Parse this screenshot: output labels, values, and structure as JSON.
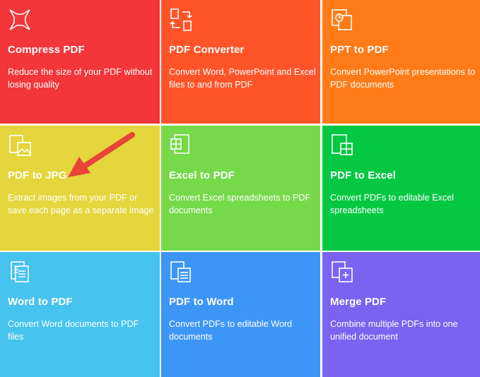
{
  "tiles": [
    {
      "key": "compress",
      "title": "Compress PDF",
      "desc": "Reduce the size of your PDF without losing quality",
      "color": "#f2363a",
      "icon": "compress-icon"
    },
    {
      "key": "converter",
      "title": "PDF Converter",
      "desc": "Convert Word, PowerPoint and Excel files to and from PDF",
      "color": "#ff5429",
      "icon": "convert-arrows-icon"
    },
    {
      "key": "ppt",
      "title": "PPT to PDF",
      "desc": "Convert PowerPoint presentations to PDF documents",
      "color": "#ff7b17",
      "icon": "ppt-icon"
    },
    {
      "key": "jpg",
      "title": "PDF to JPG",
      "desc": "Extract images from your PDF or save each page as a separate image",
      "color": "#e4d63c",
      "icon": "image-icon"
    },
    {
      "key": "exceltopdf",
      "title": "Excel to PDF",
      "desc": "Convert Excel spreadsheets to PDF documents",
      "color": "#76d94a",
      "icon": "excel-icon"
    },
    {
      "key": "pdftoexcel",
      "title": "PDF to Excel",
      "desc": "Convert PDFs to editable Excel spreadsheets",
      "color": "#05c842",
      "icon": "excel-out-icon"
    },
    {
      "key": "word",
      "title": "Word to PDF",
      "desc": "Convert Word documents to PDF files",
      "color": "#46c3ee",
      "icon": "word-icon"
    },
    {
      "key": "pdftoword",
      "title": "PDF to Word",
      "desc": "Convert PDFs to editable Word documents",
      "color": "#3d96f5",
      "icon": "word-out-icon"
    },
    {
      "key": "merge",
      "title": "Merge PDF",
      "desc": "Combine multiple PDFs into one unified document",
      "color": "#7a63f0",
      "icon": "merge-icon"
    }
  ],
  "annotation": {
    "arrow_color": "#e8443a"
  }
}
